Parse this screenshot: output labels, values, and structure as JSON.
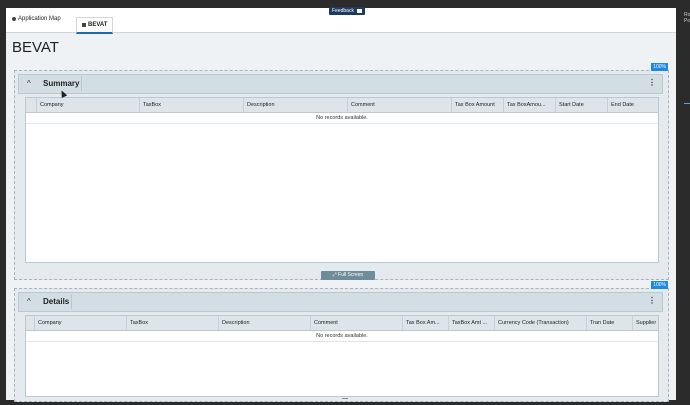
{
  "feedback": {
    "label": "Feedback"
  },
  "tabs": [
    {
      "label": "Application Map",
      "icon": "globe-icon"
    },
    {
      "label": "BEVAT",
      "icon": "grid-icon"
    }
  ],
  "page_title": "BEVAT",
  "right_edge": {
    "text_line_1": "Ro",
    "text_line_2": "Po"
  },
  "summary": {
    "percent": "100%",
    "title": "Summary",
    "columns": [
      "Company",
      "TaxBox",
      "Description",
      "Comment",
      "Tax Box Amount",
      "Tax BoxAmou...",
      "Start Date",
      "End Date"
    ],
    "empty_text": "No records available.",
    "full_screen_label": "Full Screen"
  },
  "details": {
    "percent": "100%",
    "title": "Details",
    "columns": [
      "Company",
      "TaxBox",
      "Description",
      "Comment",
      "Tax Box Am...",
      "TaxBox Amt ...",
      "Currency Code (Transaction)",
      "Tran Date",
      "Supplier"
    ],
    "empty_text": "No records available."
  },
  "colors": {
    "accent": "#1e88e5",
    "header_bg": "#d3dee4",
    "tab_underline": "#1e6aa8"
  }
}
